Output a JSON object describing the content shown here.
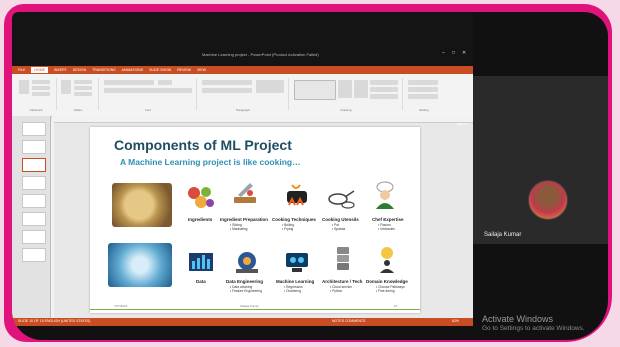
{
  "window": {
    "title": "Machine Learning project - PowerPoint (Product Activation Failed)",
    "controls": [
      "–",
      "□",
      "✕"
    ]
  },
  "ribbon": {
    "tabs": [
      "FILE",
      "HOME",
      "INSERT",
      "DESIGN",
      "TRANSITIONS",
      "ANIMATIONS",
      "SLIDE SHOW",
      "REVIEW",
      "VIEW"
    ],
    "active_tab": "HOME",
    "sign_in": "Sign in",
    "groups": [
      "Clipboard",
      "Slides",
      "Font",
      "Paragraph",
      "Drawing",
      "Editing"
    ]
  },
  "slide": {
    "title": "Components of ML Project",
    "subtitle": "A Machine Learning project is like cooking…",
    "top_row": [
      {
        "label": "Ingredients",
        "bullets": []
      },
      {
        "label": "Ingredient Preparation",
        "bullets": [
          "• Slicing",
          "• Marinating"
        ]
      },
      {
        "label": "Cooking Techniques",
        "bullets": [
          "• Boiling",
          "• Frying"
        ]
      },
      {
        "label": "Cooking Utensils",
        "bullets": [
          "• Pot",
          "• Spatula"
        ]
      },
      {
        "label": "Chef Expertise",
        "bullets": [
          "• Flavors",
          "• Intricacies"
        ]
      }
    ],
    "bottom_row": [
      {
        "label": "Data",
        "bullets": []
      },
      {
        "label": "Data Engineering",
        "bullets": [
          "• Data cleaning",
          "• Feature Engineering"
        ]
      },
      {
        "label": "Machine Learning",
        "bullets": [
          "• Regression",
          "• Clustering"
        ]
      },
      {
        "label": "Architecture / Tech",
        "bullets": [
          "• Cloud service",
          "• Python"
        ]
      },
      {
        "label": "Domain Knowledge",
        "bullets": [
          "• Choose Pathways",
          "• Fine-tuning"
        ]
      }
    ],
    "footer_left": "7/27/2023",
    "footer_center": "Sailaja Kumar",
    "footer_right": "10"
  },
  "statusbar": {
    "left": "SLIDE 10 OF 15   ENGLISH (UNITED STATES)",
    "right": "NOTES   COMMENTS",
    "zoom": "62%"
  },
  "meeting": {
    "participant_name": "Sailaja Kumar"
  },
  "watermark": {
    "title": "Activate Windows",
    "subtitle": "Go to Settings to activate Windows."
  },
  "colors": {
    "frame": "#e0127c",
    "ppt_accent": "#c94d22",
    "slide_title": "#1f4e63",
    "slide_subtitle": "#2e8fb5"
  }
}
